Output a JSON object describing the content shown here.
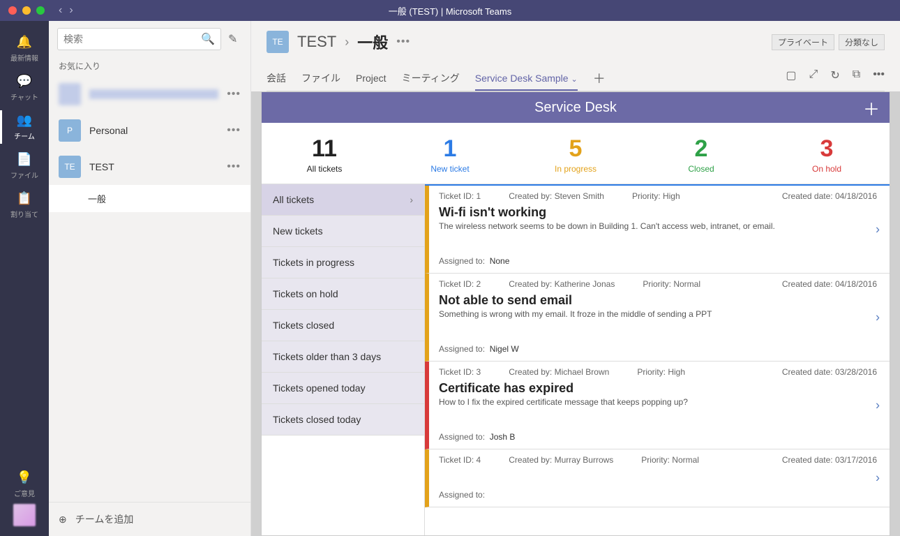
{
  "window": {
    "title": "一般 (TEST) | Microsoft Teams"
  },
  "rail": {
    "items": [
      {
        "icon": "🔔",
        "label": "最新情報"
      },
      {
        "icon": "💬",
        "label": "チャット"
      },
      {
        "icon": "👥",
        "label": "チーム"
      },
      {
        "icon": "📄",
        "label": "ファイル"
      },
      {
        "icon": "📋",
        "label": "割り当て"
      }
    ],
    "feedback": {
      "icon": "💡",
      "label": "ご意見"
    }
  },
  "search": {
    "placeholder": "検索"
  },
  "sections": {
    "favorites": "お気に入り"
  },
  "teams": [
    {
      "initials": "",
      "name": "",
      "color": "#6984d6"
    },
    {
      "initials": "P",
      "name": "Personal",
      "color": "#8ab4db"
    },
    {
      "initials": "TE",
      "name": "TEST",
      "color": "#8ab4db"
    }
  ],
  "channel": {
    "name": "一般"
  },
  "teams_join": "チームを追加",
  "header": {
    "team_initials": "TE",
    "team_name": "TEST",
    "channel_name": "一般",
    "privacy": "プライベート",
    "classification": "分類なし"
  },
  "tabs": {
    "items": [
      "会話",
      "ファイル",
      "Project",
      "ミーティング",
      "Service Desk Sample"
    ],
    "active_index": 4
  },
  "sd": {
    "title": "Service Desk",
    "stats": [
      {
        "num": "11",
        "label": "All tickets",
        "color": "#222222"
      },
      {
        "num": "1",
        "label": "New ticket",
        "color": "#2c7be5"
      },
      {
        "num": "5",
        "label": "In progress",
        "color": "#e3a21a"
      },
      {
        "num": "2",
        "label": "Closed",
        "color": "#2ea147"
      },
      {
        "num": "3",
        "label": "On hold",
        "color": "#d83a3a"
      }
    ],
    "filters": [
      "All tickets",
      "New tickets",
      "Tickets in progress",
      "Tickets on hold",
      "Tickets closed",
      "Tickets older than 3 days",
      "Tickets opened today",
      "Tickets closed today"
    ],
    "tickets": [
      {
        "id": "1",
        "creator": "Steven Smith",
        "priority": "High",
        "created": "04/18/2016",
        "title": "Wi-fi isn't working",
        "desc": "The wireless network seems to be down in Building 1. Can't access web, intranet, or email.",
        "assigned": "None",
        "color": "#e3a21a"
      },
      {
        "id": "2",
        "creator": "Katherine Jonas",
        "priority": "Normal",
        "created": "04/18/2016",
        "title": "Not able to send email",
        "desc": "Something is wrong with my email. It froze in the middle of sending a PPT",
        "assigned": "Nigel W",
        "color": "#e3a21a"
      },
      {
        "id": "3",
        "creator": "Michael Brown",
        "priority": "High",
        "created": "03/28/2016",
        "title": "Certificate has expired",
        "desc": "How to I fix the expired certificate message that keeps popping up?",
        "assigned": "Josh B",
        "color": "#d83a3a"
      },
      {
        "id": "4",
        "creator": "Murray Burrows",
        "priority": "Normal",
        "created": "03/17/2016",
        "title": "",
        "desc": "",
        "assigned": "",
        "color": "#e3a21a"
      }
    ],
    "labels": {
      "ticket_id": "Ticket ID:",
      "created_by": "Created by:",
      "priority": "Priority:",
      "created_date": "Created date:",
      "assigned_to": "Assigned to:"
    }
  }
}
